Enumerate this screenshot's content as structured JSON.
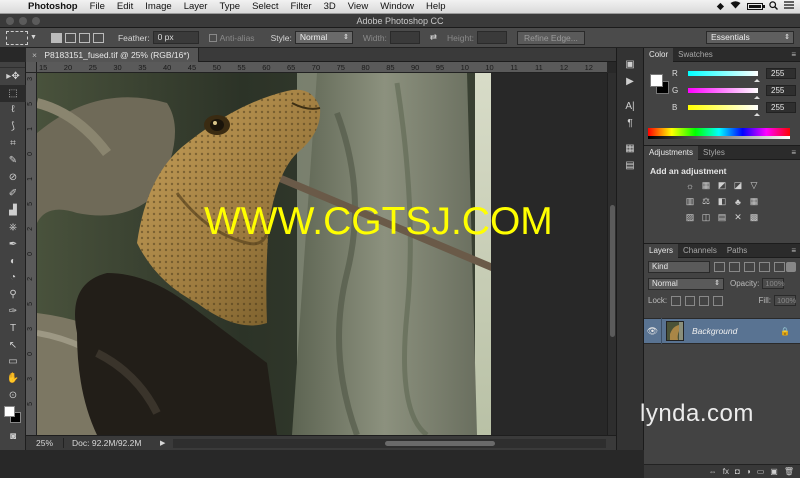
{
  "menubar": {
    "apple": "",
    "app": "Photoshop",
    "items": [
      "File",
      "Edit",
      "Image",
      "Layer",
      "Type",
      "Select",
      "Filter",
      "3D",
      "View",
      "Window",
      "Help"
    ]
  },
  "window": {
    "title": "Adobe Photoshop CC"
  },
  "options": {
    "feather_label": "Feather:",
    "feather_value": "0 px",
    "antialias_label": "Anti-alias",
    "style_label": "Style:",
    "style_value": "Normal",
    "width_label": "Width:",
    "height_label": "Height:",
    "refine_label": "Refine Edge...",
    "workspace_value": "Essentials"
  },
  "document": {
    "tab_label": "P8183151_fused.tif @ 25% (RGB/16*)",
    "close_glyph": "×",
    "ruler_h": [
      "15",
      "20",
      "25",
      "30",
      "35",
      "40",
      "45",
      "50",
      "55",
      "60",
      "65",
      "70",
      "75",
      "80",
      "85",
      "90",
      "95",
      "10",
      "10",
      "11",
      "11",
      "12",
      "12"
    ],
    "ruler_v": [
      "3",
      "5",
      "1",
      "0",
      "1",
      "5",
      "2",
      "0",
      "2",
      "5",
      "3",
      "0",
      "3",
      "5"
    ],
    "zoom": "25%",
    "doc_info": "Doc: 92.2M/92.2M",
    "status_arrow": "▶"
  },
  "watermark": "WWW.CGTSJ.COM",
  "panels": {
    "color_tabs": [
      "Color",
      "Swatches"
    ],
    "panel_menu": "≡",
    "rgb": [
      {
        "label": "R",
        "value": "255",
        "color": "#ff0000"
      },
      {
        "label": "G",
        "value": "255",
        "color": "#00ff00"
      },
      {
        "label": "B",
        "value": "255",
        "color": "#0000ff"
      }
    ],
    "adjustments_tabs": [
      "Adjustments",
      "Styles"
    ],
    "add_adjustment": "Add an adjustment",
    "layers_tabs": [
      "Layers",
      "Channels",
      "Paths"
    ],
    "kind_value": "Kind",
    "blend_value": "Normal",
    "opacity_label": "Opacity:",
    "opacity_value": "100%",
    "lock_label": "Lock:",
    "fill_label": "Fill:",
    "fill_value": "100%",
    "layer_name": "Background",
    "layer_eye": "👁",
    "layer_lock": "🔒",
    "footer_icons": [
      "⇔",
      "fx",
      "◘",
      "◑",
      "▭",
      "▣",
      "🗑"
    ]
  },
  "tools": [
    "▸✥",
    "⬚",
    "ℓ",
    "⟆",
    "⌗",
    "✎",
    "⊘",
    "✐",
    "▟",
    "⎈",
    "✒",
    "◐",
    "◔",
    "⚲",
    "✑",
    "T",
    "↖",
    "▭",
    "✋",
    "⊙"
  ],
  "dock_icons": [
    "▣",
    "▶",
    "A|",
    "¶",
    "▦",
    "▤"
  ],
  "adj_icons": [
    [
      "☼",
      "▦",
      "◩",
      "◪",
      "▽"
    ],
    [
      "▥",
      "⚖",
      "◧",
      "♣",
      "▦"
    ],
    [
      "▨",
      "◫",
      "▤",
      "✕",
      "▩"
    ]
  ],
  "brand": "lynda.com"
}
